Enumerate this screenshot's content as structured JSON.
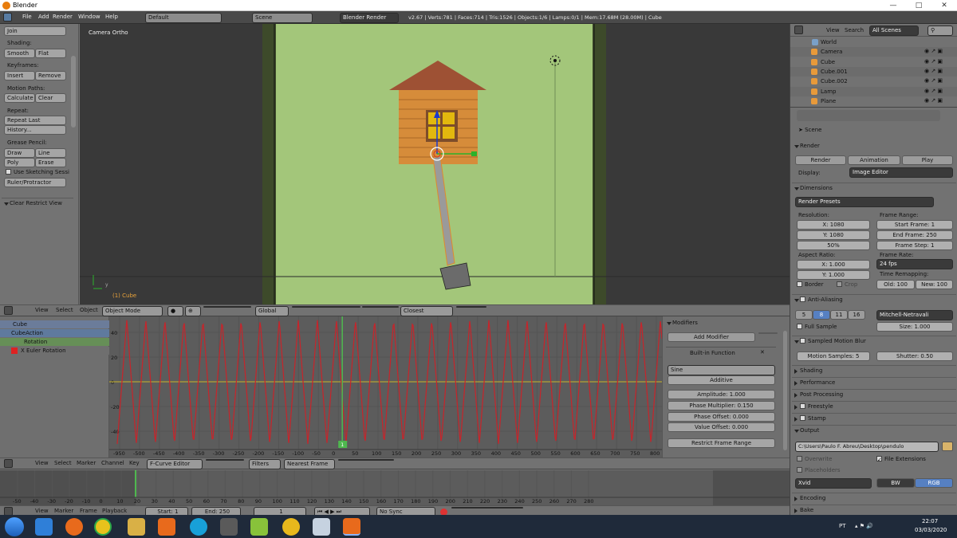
{
  "window": {
    "title": "Blender"
  },
  "infobar": {
    "menus": [
      "File",
      "Add",
      "Render",
      "Window",
      "Help"
    ],
    "screen": "Default",
    "scene": "Scene",
    "engine": "Blender Render",
    "stats": "v2.67 | Verts:781 | Faces:714 | Tris:1526 | Objects:1/6 | Lamps:0/1 | Mem:17.68M (28.00M) | Cube"
  },
  "toolshelf": {
    "join": "Join",
    "shading_label": "Shading:",
    "smooth": "Smooth",
    "flat": "Flat",
    "keyframes_label": "Keyframes:",
    "insert": "Insert",
    "remove": "Remove",
    "motion_label": "Motion Paths:",
    "calculate": "Calculate",
    "clear": "Clear",
    "repeat_label": "Repeat:",
    "repeat_last": "Repeat Last",
    "history": "History...",
    "grease_label": "Grease Pencil:",
    "draw": "Draw",
    "line": "Line",
    "poly": "Poly",
    "erase": "Erase",
    "sketching": "Use Sketching Sessi",
    "ruler": "Ruler/Protractor",
    "clear_restrict": "Clear Restrict View"
  },
  "viewport": {
    "view_name": "Camera Ortho",
    "object_label": "(1) Cube",
    "axis_y": "y"
  },
  "vp_header": {
    "view": "View",
    "select": "Select",
    "object": "Object",
    "mode": "Object Mode",
    "orientation": "Global",
    "snap": "Closest"
  },
  "channels": {
    "cube": "Cube",
    "action": "CubeAction",
    "group": "Rotation",
    "fcurve": "X Euler Rotation"
  },
  "graph": {
    "y_ticks": [
      "40",
      "20",
      "0",
      "-20",
      "-40"
    ],
    "x_ticks": [
      "-950",
      "-500",
      "-450",
      "-400",
      "-350",
      "-300",
      "-250",
      "-200",
      "-150",
      "-100",
      "-50",
      "0",
      "50",
      "100",
      "150",
      "200",
      "250",
      "300",
      "350",
      "400",
      "450",
      "500",
      "550",
      "600",
      "650",
      "700",
      "750",
      "800"
    ],
    "current_frame": "1",
    "curve_color": "#c8242a",
    "cursor_color": "#4fb84f"
  },
  "modifiers": {
    "title": "Modifiers",
    "add": "Add Modifier",
    "name": "Built-in Function",
    "func": "Sine",
    "mode": "Additive",
    "amplitude": "Amplitude: 1.000",
    "phase_mult": "Phase Multiplier: 0.150",
    "phase_off": "Phase Offset: 0.000",
    "value_off": "Value Offset: 0.000",
    "restrict": "Restrict Frame Range"
  },
  "graph_header": {
    "view": "View",
    "select": "Select",
    "marker": "Marker",
    "channel": "Channel",
    "key": "Key",
    "editor": "F-Curve Editor",
    "filters": "Filters",
    "pivot": "Nearest Frame"
  },
  "timeline": {
    "ticks": [
      "-50",
      "-40",
      "-30",
      "-20",
      "-10",
      "0",
      "10",
      "20",
      "30",
      "40",
      "50",
      "60",
      "70",
      "80",
      "90",
      "100",
      "110",
      "120",
      "130",
      "140",
      "150",
      "160",
      "170",
      "180",
      "190",
      "200",
      "210",
      "220",
      "230",
      "240",
      "250",
      "260",
      "270",
      "280"
    ]
  },
  "playback": {
    "view": "View",
    "marker": "Marker",
    "frame": "Frame",
    "playback": "Playback",
    "start": "Start: 1",
    "end": "End: 250",
    "current": "1",
    "sync": "No Sync"
  },
  "outliner": {
    "view": "View",
    "search": "Search",
    "filter": "All Scenes",
    "items": [
      "World",
      "Camera",
      "Cube",
      "Cube.001",
      "Cube.002",
      "Lamp",
      "Plane"
    ]
  },
  "props": {
    "scene": "Scene",
    "render": "Render",
    "render_btn": "Render",
    "animation_btn": "Animation",
    "play_btn": "Play",
    "display_label": "Display:",
    "display": "Image Editor",
    "dimensions": "Dimensions",
    "presets": "Render Presets",
    "resolution_label": "Resolution:",
    "res_x": "X: 1080",
    "res_y": "Y: 1080",
    "res_pct": "50%",
    "frame_range_label": "Frame Range:",
    "start_frame": "Start Frame: 1",
    "end_frame": "End Frame: 250",
    "frame_step": "Frame Step: 1",
    "aspect_label": "Aspect Ratio:",
    "asp_x": "X: 1.000",
    "asp_y": "Y: 1.000",
    "frame_rate_label": "Frame Rate:",
    "fps": "24 fps",
    "remap_label": "Time Remapping:",
    "old": "Old: 100",
    "new": "New: 100",
    "border": "Border",
    "crop": "Crop",
    "aa": "Anti-Aliasing",
    "aa_5": "5",
    "aa_8": "8",
    "aa_11": "11",
    "aa_16": "16",
    "aa_filter": "Mitchell-Netravali",
    "full_sample": "Full Sample",
    "aa_size": "Size: 1.000",
    "mblur": "Sampled Motion Blur",
    "mb_samples": "Motion Samples: 5",
    "shutter": "Shutter: 0.50",
    "shading": "Shading",
    "performance": "Performance",
    "post": "Post Processing",
    "freestyle": "Freestyle",
    "stamp": "Stamp",
    "output": "Output",
    "path": "C:\\Users\\Paulo F. Abreu\\Desktop\\pendulo",
    "overwrite": "Overwrite",
    "file_ext": "File Extensions",
    "placeholders": "Placeholders",
    "format": "Xvid",
    "bw": "BW",
    "rgb": "RGB",
    "encoding": "Encoding",
    "bake": "Bake"
  },
  "taskbar": {
    "lang": "PT",
    "time": "22:07",
    "date": "03/03/2020"
  }
}
